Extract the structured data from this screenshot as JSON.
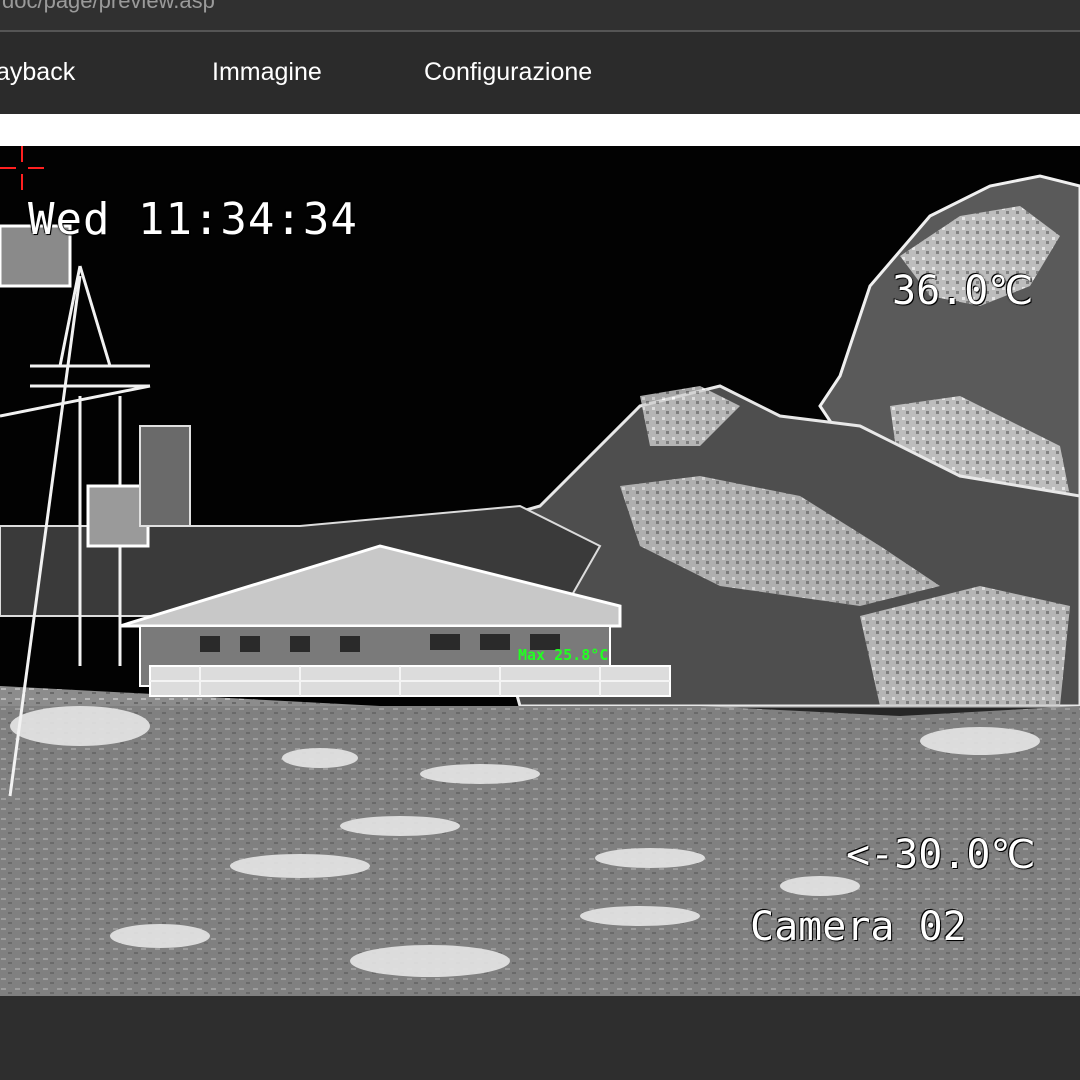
{
  "browser": {
    "url_fragment": "doc/page/preview.asp"
  },
  "nav": {
    "items": [
      {
        "label": "ayback"
      },
      {
        "label": "Immagine"
      },
      {
        "label": "Configurazione"
      }
    ]
  },
  "video": {
    "osd_datetime": "Wed 11:34:34",
    "temp_max_scale": "36.0℃",
    "temp_min_scale": "<-30.0℃",
    "camera_name": "Camera 02",
    "max_label": "Max 25.8°C"
  },
  "colors": {
    "osd_text": "#ffffff",
    "max_marker": "#22ff22",
    "crosshair": "#ff2020"
  }
}
